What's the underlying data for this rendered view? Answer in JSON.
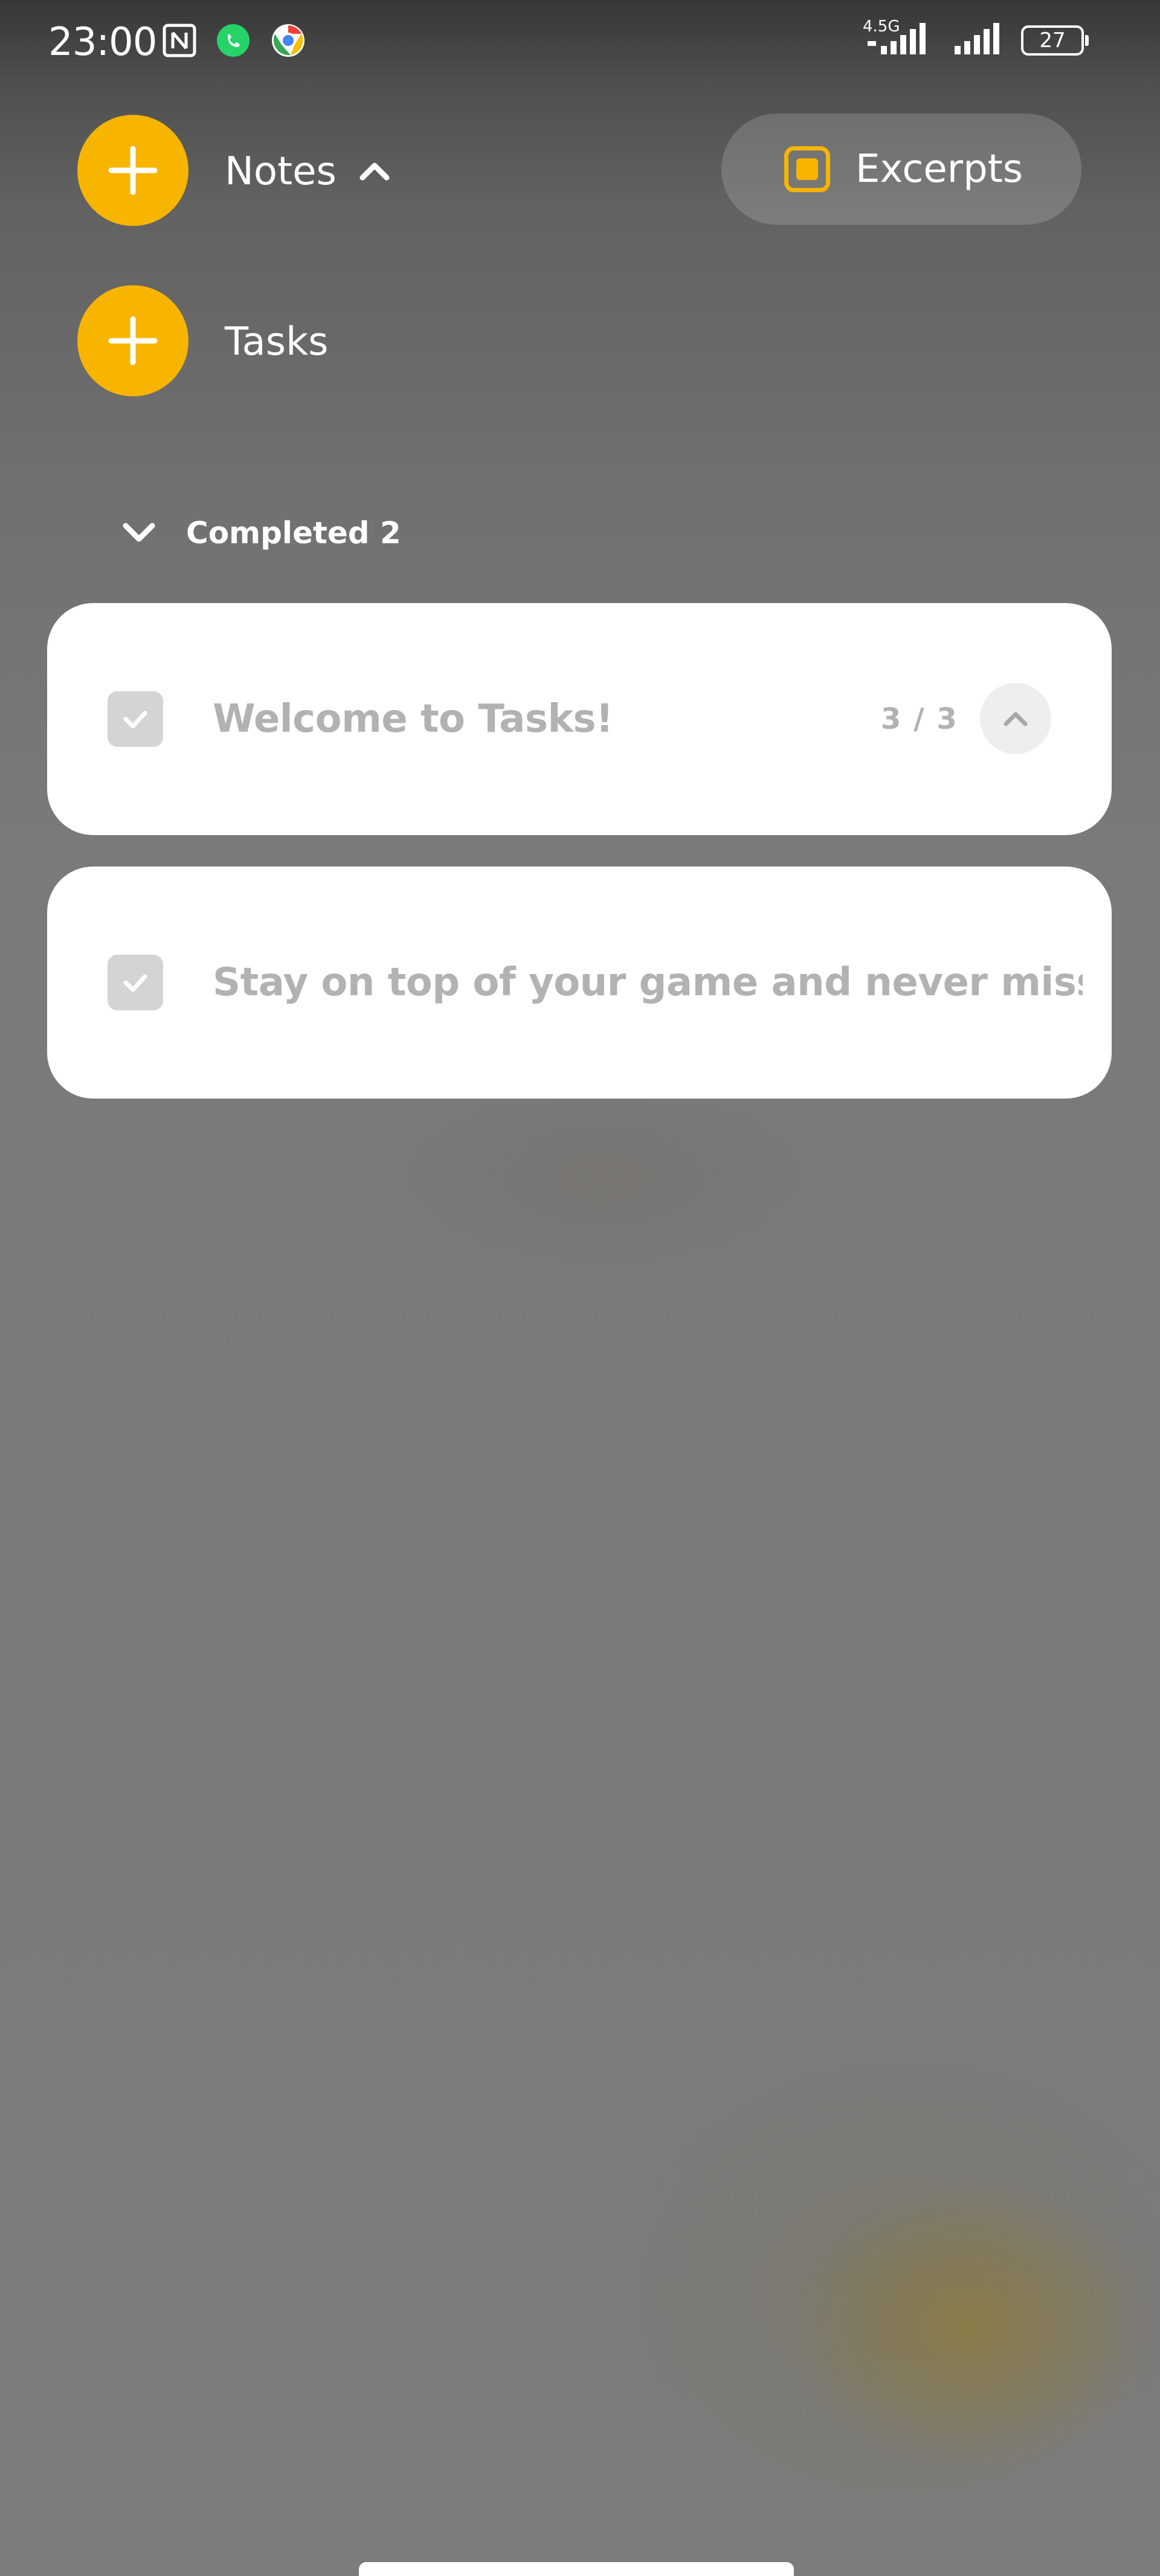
{
  "status_bar": {
    "time": "23:00",
    "network": "4.5G",
    "battery": "27",
    "icons": [
      "nfc-icon",
      "whatsapp-icon",
      "chrome-icon",
      "signal-icon",
      "signal-icon",
      "battery-icon"
    ]
  },
  "header": {
    "notes_label": "Notes",
    "tasks_label": "Tasks",
    "excerpts_label": "Excerpts",
    "notes_chevron": "chevron-up-icon",
    "add_icon": "plus-icon"
  },
  "completed": {
    "label": "Completed 2",
    "chevron": "chevron-down-icon"
  },
  "tasks": [
    {
      "title": "Welcome to Tasks!",
      "progress": "3 / 3",
      "completed": true
    },
    {
      "title": "Stay on top of your game and never miss ...",
      "completed": true
    }
  ],
  "colors": {
    "accent": "#f7b500",
    "card": "#ffffff",
    "completed_text": "#b2b2b2",
    "checkbox": "#d4d4d4"
  }
}
